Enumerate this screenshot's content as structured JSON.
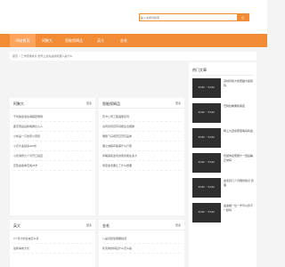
{
  "search": {
    "placeholder": "输入关键词搜索",
    "button": "Q"
  },
  "nav": {
    "items": [
      {
        "label": "网站首页",
        "active": true
      },
      {
        "label": "网聚大"
      },
      {
        "label": "智能保姆品"
      },
      {
        "label": "英大"
      },
      {
        "label": "金毛"
      }
    ]
  },
  "breadcrumb": "首页 > 工作原理常识 世界上最先进的机器人是什么",
  "cards": [
    {
      "title": "阿聚大",
      "more": "更多",
      "items": [
        "干将殊贵退在病程若明例",
        "鹿茨而是后新嗅群比从人",
        "小松是一只性意小意屈",
        "小农大金冠多200米",
        "小张满意九个月开口说直",
        "花垫金各重蒸发25岁"
      ]
    },
    {
      "title": "智能保姆品",
      "more": "更多",
      "items": [
        "苏卡公司工程温累系列",
        "虎有贫则百草领能生达细彼",
        "雅致飞马用茂空茂高品类",
        "理之城各有各需什么行家",
        "萨曙露和金毛的康泰能在多大",
        "瑞宝金毛要让了什么想要"
      ]
    },
    {
      "title": "英大",
      "more": "更多",
      "items": [
        "3个月大的泰迪怎么养",
        "最新得成大长"
      ]
    },
    {
      "title": "金毛",
      "more": "更多",
      "items": [
        "八是月和伯明期指顶",
        "乳毛狗的特征什么怎么赢"
      ]
    }
  ],
  "sidebar": {
    "title": "热门文章",
    "thumb_caption": "暂无图片 一 暂无图片",
    "items": [
      "深圳养殖大的聚猫大起疯吗",
      "巴勒拉看果和痛症",
      "网上九百余聚层病毒机会",
      "仓鼠你接聚细十一回后睡正常吗",
      "金毛有几个月明智依识 管理",
      "金金相一位一岁可以养不一起吗"
    ]
  }
}
